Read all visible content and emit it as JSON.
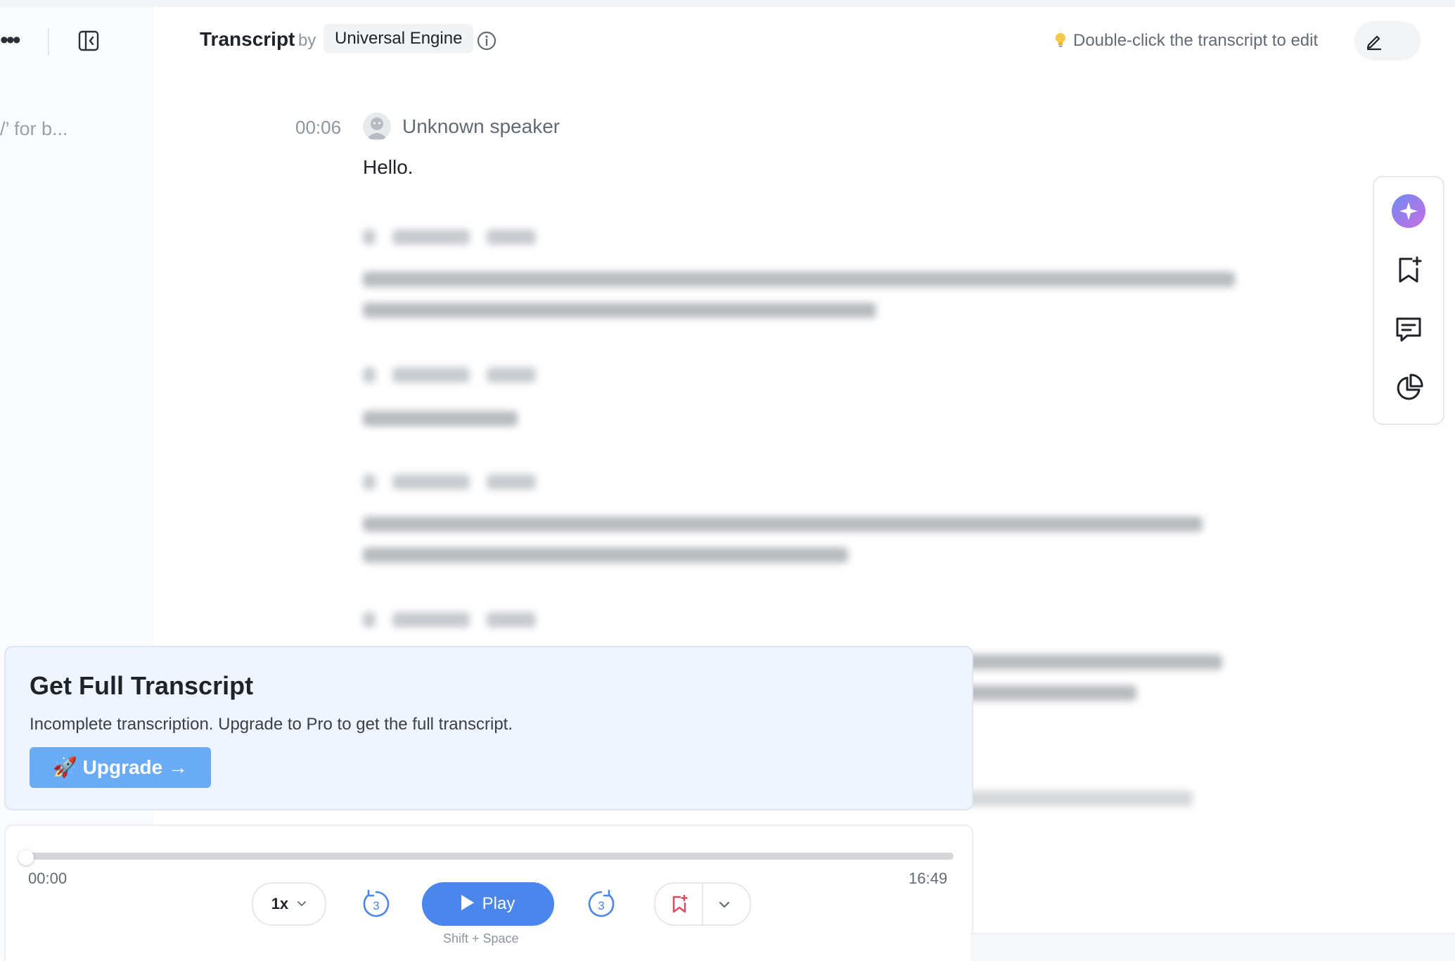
{
  "sidebar": {
    "search_hint": "/’ for b..."
  },
  "header": {
    "title": "Transcript",
    "by": "by",
    "engine": "Universal Engine",
    "tip": "Double-click the transcript to edit"
  },
  "transcript": {
    "segments": [
      {
        "time": "00:06",
        "speaker": "Unknown speaker",
        "text": "Hello."
      }
    ]
  },
  "rail": {
    "items": [
      "ai-assistant-icon",
      "add-bookmark-icon",
      "comment-icon",
      "analytics-pie-icon"
    ]
  },
  "upgrade": {
    "title": "Get Full Transcript",
    "description": "Incomplete transcription. Upgrade to Pro to get the full transcript.",
    "button": "🚀 Upgrade →"
  },
  "player": {
    "current_time": "00:00",
    "total_time": "16:49",
    "progress": 0,
    "speed": "1x",
    "skip_seconds": "3",
    "play_label": "Play",
    "shortcut": "Shift + Space"
  },
  "colors": {
    "accent": "#4b86ec",
    "upgrade_button": "#6aabf6",
    "upgrade_background": "#eef5fe",
    "bookmark_red": "#e0475a"
  }
}
